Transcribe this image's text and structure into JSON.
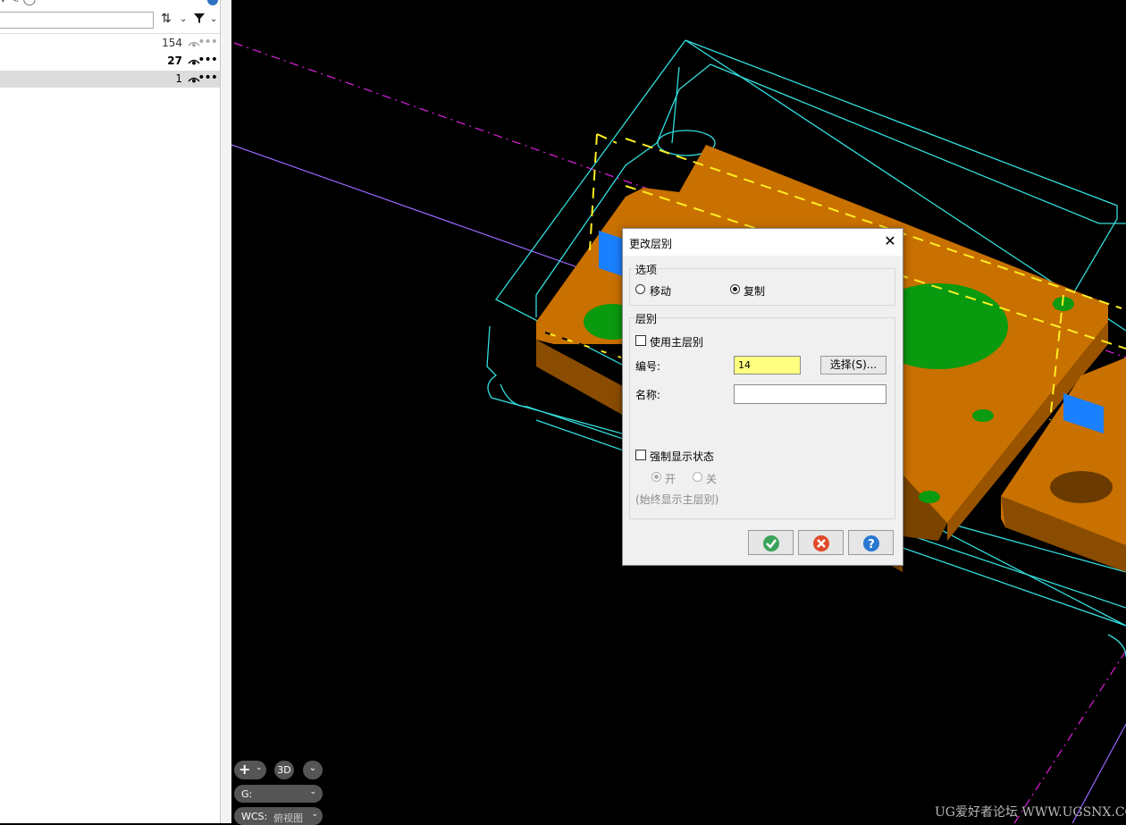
{
  "layer_panel": {
    "rows": [
      {
        "count": "154"
      },
      {
        "count": "27"
      },
      {
        "count": "1"
      }
    ]
  },
  "dialog": {
    "title": "更改层别",
    "options_group": {
      "label": "选项",
      "move": "移动",
      "copy": "复制",
      "selected": "copy"
    },
    "layer_group": {
      "label": "层别",
      "use_work_layer": "使用主层别",
      "number_label": "编号:",
      "number_value": "14",
      "select_button": "选择(S)...",
      "name_label": "名称:",
      "name_value": "",
      "force_display": "强制显示状态",
      "on": "开",
      "off": "关",
      "hint": "(始终显示主层别)"
    }
  },
  "viewport_hud": {
    "view_3d": "3D",
    "group_label": "G:",
    "wcs_label": "WCS:",
    "wcs_value": "俯视图"
  },
  "watermark": "UG爱好者论坛 WWW.UGSNX.COM",
  "colors": {
    "part_orange": "#c87000",
    "wire_cyan": "#33dddd",
    "highlight_yellow": "#ffff80"
  }
}
